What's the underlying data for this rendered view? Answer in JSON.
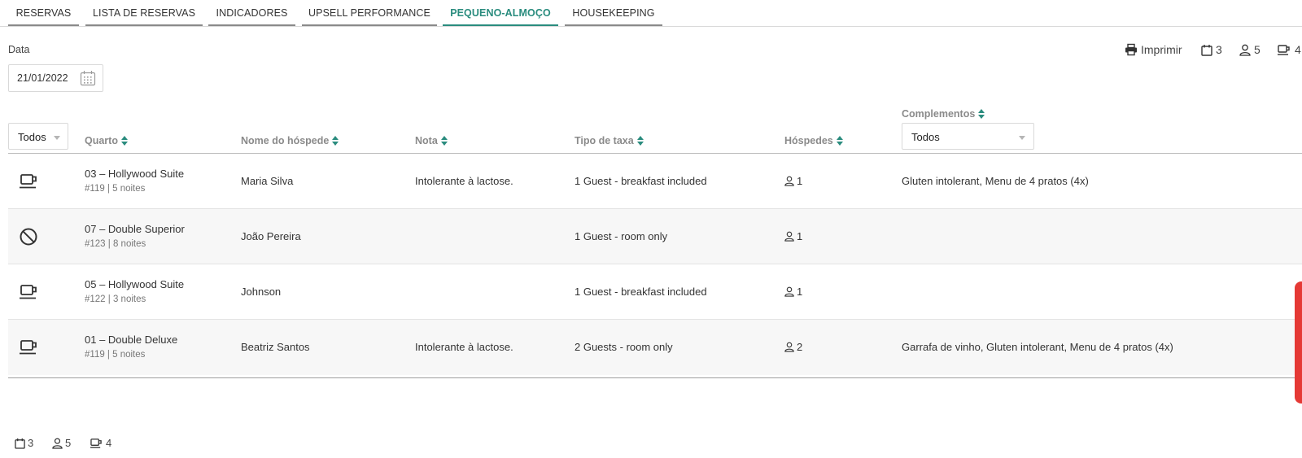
{
  "tabs": [
    {
      "label": "RESERVAS",
      "active": false
    },
    {
      "label": "LISTA DE RESERVAS",
      "active": false
    },
    {
      "label": "INDICADORES",
      "active": false
    },
    {
      "label": "UPSELL PERFORMANCE",
      "active": false
    },
    {
      "label": "PEQUENO-ALMOÇO",
      "active": true
    },
    {
      "label": "HOUSEKEEPING",
      "active": false
    }
  ],
  "date_filter": {
    "label": "Data",
    "value": "21/01/2022",
    "icon": "calendar-icon"
  },
  "toolbar": {
    "print_label": "Imprimir",
    "reservations_count": "3",
    "guests_count": "5",
    "breakfast_count": "4"
  },
  "filters": {
    "status_select": "Todos",
    "complements_label": "Complementos",
    "complements_select": "Todos"
  },
  "columns": {
    "room": "Quarto",
    "guest_name": "Nome do hóspede",
    "note": "Nota",
    "rate_type": "Tipo de taxa",
    "guests": "Hóspedes"
  },
  "rows": [
    {
      "status_icon": "coffee-cup-icon",
      "room": "03 – Hollywood Suite",
      "sub": "#119 | 5 noites",
      "guest_name": "Maria Silva",
      "note": "Intolerante à lactose.",
      "rate_type": "1 Guest - breakfast included",
      "guests": "1",
      "complements": "Gluten intolerant, Menu de 4 pratos (4x)"
    },
    {
      "status_icon": "no-breakfast-icon",
      "room": "07 – Double Superior",
      "sub": "#123 | 8 noites",
      "guest_name": "João Pereira",
      "note": "",
      "rate_type": "1 Guest - room only",
      "guests": "1",
      "complements": ""
    },
    {
      "status_icon": "coffee-cup-icon",
      "room": "05 – Hollywood Suite",
      "sub": "#122 | 3 noites",
      "guest_name": "Johnson",
      "note": "",
      "rate_type": "1 Guest - breakfast included",
      "guests": "1",
      "complements": ""
    },
    {
      "status_icon": "coffee-cup-icon",
      "room": "01 – Double Deluxe",
      "sub": "#119 | 5 noites",
      "guest_name": "Beatriz Santos",
      "note": "Intolerante à lactose.",
      "rate_type": "2 Guests - room only",
      "guests": "2",
      "complements": "Garrafa de vinho, Gluten intolerant, Menu de 4 pratos (4x)"
    }
  ],
  "footer": {
    "reservations_count": "3",
    "guests_count": "5",
    "breakfast_count": "4"
  },
  "colors": {
    "accent": "#2a8c7e",
    "side_handle": "#e53935"
  }
}
